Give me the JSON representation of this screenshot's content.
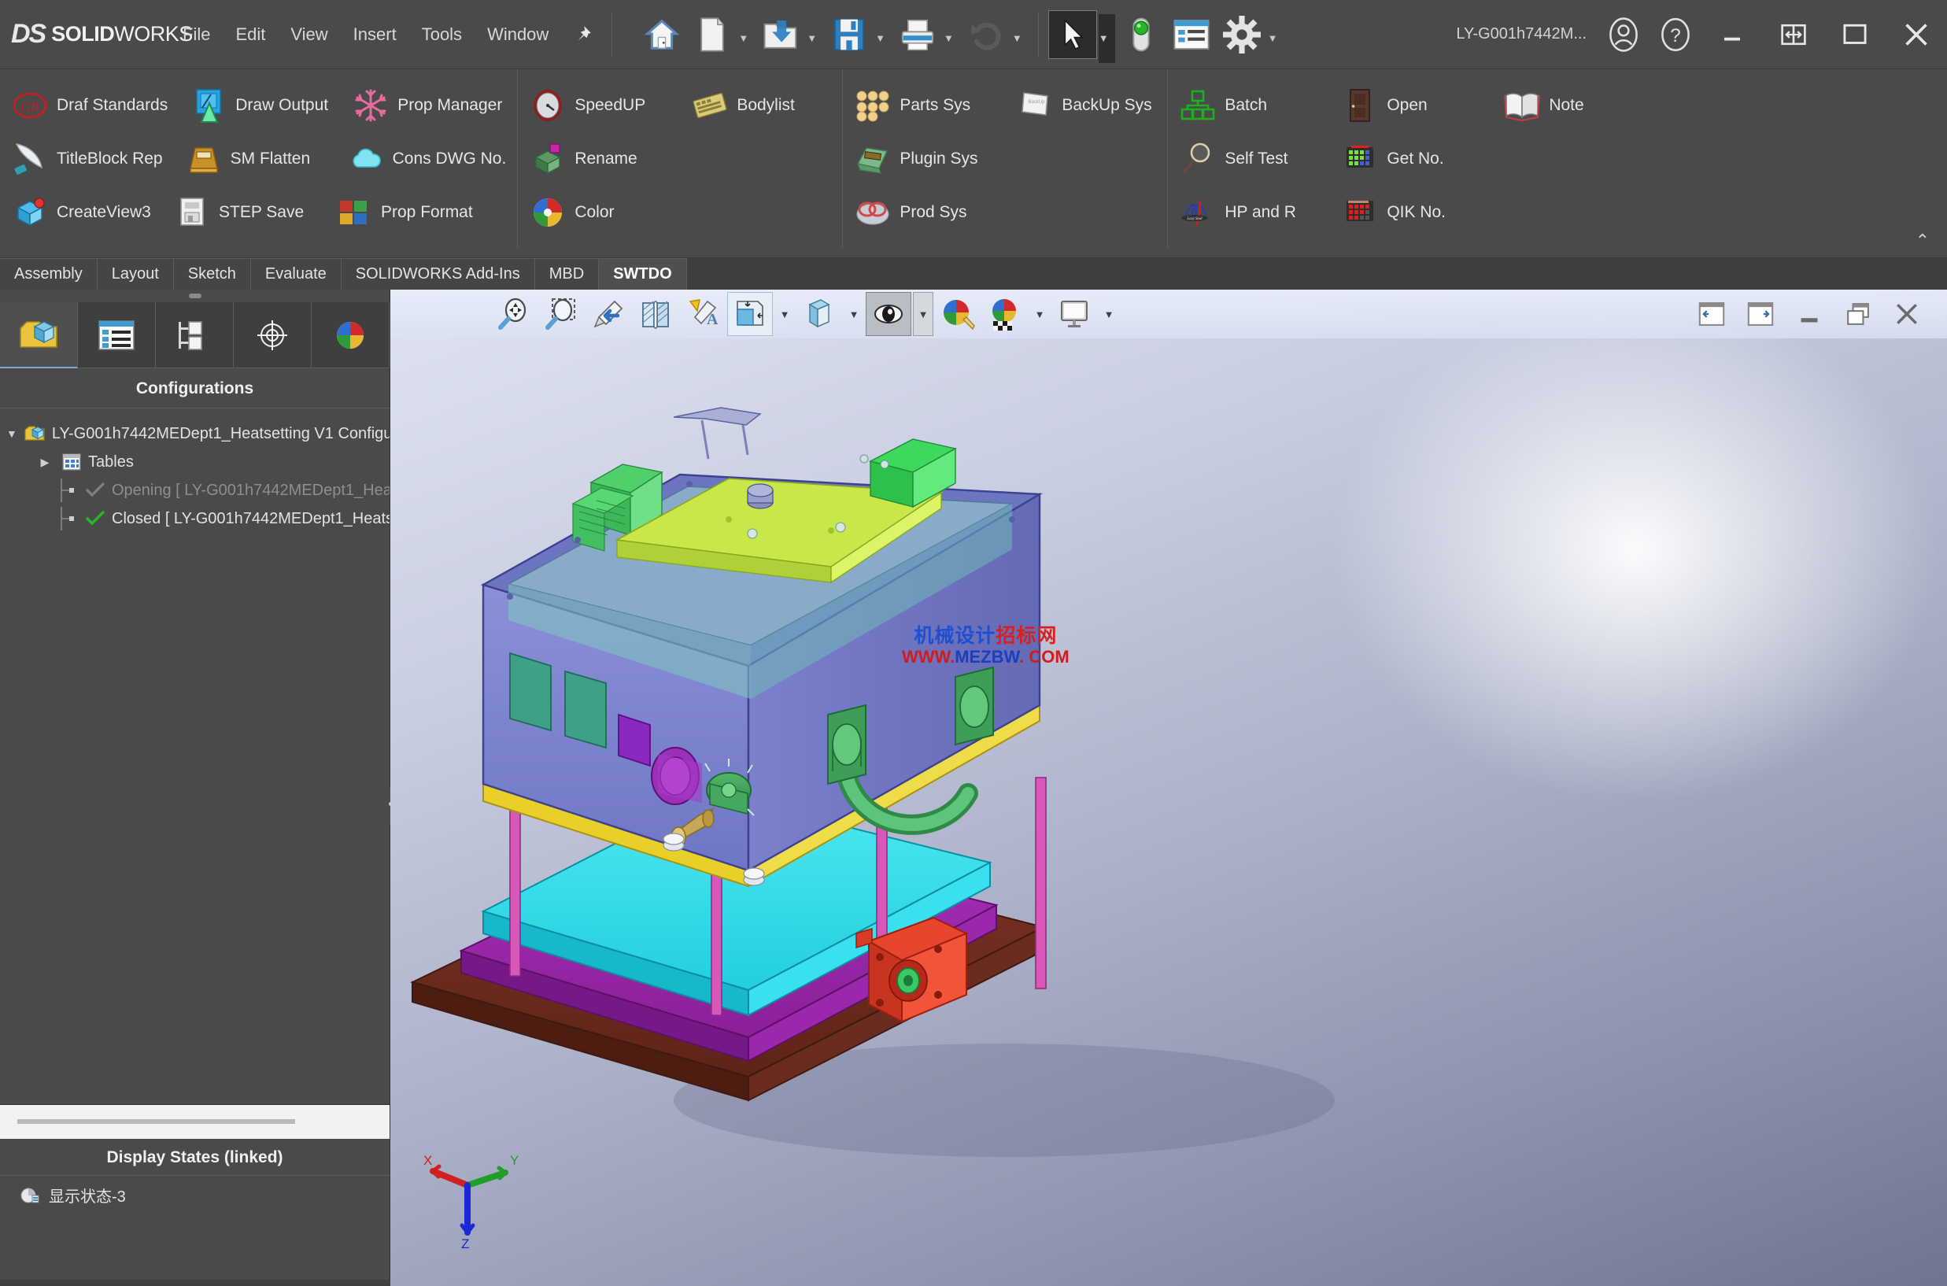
{
  "app": {
    "brand_ds": "DS",
    "brand_bold": "SOLID",
    "brand_light": "WORKS",
    "document_name": "LY-G001h7442M..."
  },
  "menubar": {
    "items": [
      {
        "label": "File"
      },
      {
        "label": "Edit"
      },
      {
        "label": "View"
      },
      {
        "label": "Insert"
      },
      {
        "label": "Tools"
      },
      {
        "label": "Window"
      }
    ],
    "pin_icon": "pushpin-icon"
  },
  "quick_access": {
    "buttons": [
      {
        "name": "home-icon",
        "label": "Home",
        "caret": false
      },
      {
        "name": "new-document-icon",
        "label": "New",
        "caret": true
      },
      {
        "name": "open-folder-icon",
        "label": "Open",
        "caret": true
      },
      {
        "name": "save-icon",
        "label": "Save",
        "caret": true
      },
      {
        "name": "print-icon",
        "label": "Print",
        "caret": true
      },
      {
        "name": "undo-icon",
        "label": "Undo",
        "caret": true
      },
      {
        "name": "select-arrow-icon",
        "label": "Select",
        "caret": true
      },
      {
        "name": "rebuild-icon",
        "label": "Rebuild",
        "caret": false
      },
      {
        "name": "options-list-icon",
        "label": "Options List",
        "caret": false
      },
      {
        "name": "settings-gear-icon",
        "label": "Options",
        "caret": true
      }
    ]
  },
  "title_right": {
    "account_icon": "user-account-icon",
    "help_icon": "help-question-icon",
    "minimize_icon": "minimize-icon",
    "restore_split_icon": "restore-split-icon",
    "maximize_icon": "maximize-icon",
    "close_icon": "close-icon"
  },
  "ribbon": {
    "collapse_icon": "chevron-up-icon",
    "groups": [
      {
        "name": "group-1",
        "rows": [
          [
            {
              "label": "Draf Standards",
              "icon": "gb-stamp-icon"
            },
            {
              "label": "Draw Output",
              "icon": "blue-drawing-icon"
            },
            {
              "label": "Prop Manager",
              "icon": "snowflake-icon"
            }
          ],
          [
            {
              "label": "TitleBlock Rep",
              "icon": "blade-icon"
            },
            {
              "label": "SM Flatten",
              "icon": "gold-tray-icon"
            },
            {
              "label": "Cons DWG No.",
              "icon": "cloud-icon"
            }
          ],
          [
            {
              "label": "CreateView3",
              "icon": "view-cube-icon"
            },
            {
              "label": "STEP Save",
              "icon": "step-save-icon"
            },
            {
              "label": "Prop Format",
              "icon": "format-blocks-icon"
            }
          ]
        ]
      },
      {
        "name": "group-2",
        "rows": [
          [
            {
              "label": "SpeedUP",
              "icon": "gauge-icon"
            },
            {
              "label": "Bodylist",
              "icon": "keyboard-icon"
            }
          ],
          [
            {
              "label": "Rename",
              "icon": "rename-box-icon"
            }
          ],
          [
            {
              "label": "Color",
              "icon": "color-wheel-icon"
            }
          ]
        ]
      },
      {
        "name": "group-3",
        "rows": [
          [
            {
              "label": "Parts Sys",
              "icon": "parts-stack-icon"
            },
            {
              "label": "BackUp Sys",
              "icon": "backup-disk-icon"
            }
          ],
          [
            {
              "label": "Plugin Sys",
              "icon": "plugin-machine-icon"
            }
          ],
          [
            {
              "label": "Prod Sys",
              "icon": "prod-rings-icon"
            }
          ]
        ]
      },
      {
        "name": "group-4",
        "rows": [
          [
            {
              "label": "Batch",
              "icon": "green-batch-icon"
            },
            {
              "label": "Open",
              "icon": "door-open-icon"
            },
            {
              "label": "Note",
              "icon": "open-book-icon"
            }
          ],
          [
            {
              "label": "Self Test",
              "icon": "magnifier-icon"
            },
            {
              "label": "Get No.",
              "icon": "green-grid-icon"
            }
          ],
          [
            {
              "label": "HP and R",
              "icon": "signature-icon"
            },
            {
              "label": "QIK No.",
              "icon": "red-grid-icon"
            }
          ]
        ]
      }
    ]
  },
  "tabs": {
    "items": [
      {
        "label": "Assembly",
        "active": false
      },
      {
        "label": "Layout",
        "active": false
      },
      {
        "label": "Sketch",
        "active": false
      },
      {
        "label": "Evaluate",
        "active": false
      },
      {
        "label": "SOLIDWORKS Add-Ins",
        "active": false
      },
      {
        "label": "MBD",
        "active": false
      },
      {
        "label": "SWTDO",
        "active": true
      }
    ]
  },
  "left_panel": {
    "tabs": [
      {
        "name": "feature-manager-tab",
        "icon": "yellow-cube-tree-icon",
        "active": true
      },
      {
        "name": "property-manager-tab",
        "icon": "property-list-icon",
        "active": false
      },
      {
        "name": "configuration-manager-tab",
        "icon": "configuration-tree-icon",
        "active": false
      },
      {
        "name": "dimxpert-manager-tab",
        "icon": "crosshair-target-icon",
        "active": false
      },
      {
        "name": "display-manager-tab",
        "icon": "color-sphere-icon",
        "active": false
      }
    ],
    "title": "Configurations",
    "tree": [
      {
        "label": "LY-G001h7442MEDept1_Heatsetting V1 Configur",
        "level": 0,
        "twisty": "expanded",
        "icon": "config-root-icon",
        "dim": false
      },
      {
        "label": "Tables",
        "level": 1,
        "twisty": "collapsed",
        "icon": "tables-icon",
        "dim": false
      },
      {
        "label": "Opening [ LY-G001h7442MEDept1_Hea",
        "level": 2,
        "twisty": "none",
        "icon": "check-grey-icon",
        "dim": true
      },
      {
        "label": "Closed [ LY-G001h7442MEDept1_Heats",
        "level": 2,
        "twisty": "none",
        "icon": "check-green-icon",
        "dim": false
      }
    ],
    "display_states_title": "Display States (linked)",
    "display_states_items": [
      {
        "label": "显示状态-3",
        "icon": "display-state-icon"
      }
    ]
  },
  "viewport_toolbar": {
    "left_buttons": [
      {
        "name": "zoom-to-fit-icon",
        "label": "Zoom to Fit",
        "caret": false,
        "pressed": false
      },
      {
        "name": "zoom-to-area-icon",
        "label": "Zoom to Area",
        "caret": false,
        "pressed": false
      },
      {
        "name": "previous-view-icon",
        "label": "Previous View",
        "caret": false,
        "pressed": false
      },
      {
        "name": "section-view-icon",
        "label": "Section View",
        "caret": false,
        "pressed": false
      },
      {
        "name": "dynamic-annotation-icon",
        "label": "Dynamic Annotation Views",
        "caret": false,
        "pressed": false
      },
      {
        "name": "view-orientation-icon",
        "label": "View Orientation",
        "caret": true,
        "pressed": false
      },
      {
        "name": "display-style-icon",
        "label": "Display Style",
        "caret": true,
        "pressed": false
      },
      {
        "name": "hide-show-items-icon",
        "label": "Hide/Show Items",
        "caret": true,
        "pressed": true
      },
      {
        "name": "edit-appearance-icon",
        "label": "Edit Appearance",
        "caret": false,
        "pressed": false
      },
      {
        "name": "apply-scene-icon",
        "label": "Apply Scene",
        "caret": true,
        "pressed": false
      },
      {
        "name": "view-settings-icon",
        "label": "View Settings",
        "caret": true,
        "pressed": false
      }
    ],
    "right_buttons": [
      {
        "name": "pane-left-icon",
        "label": "Collapse Left Pane"
      },
      {
        "name": "pane-right-icon",
        "label": "Collapse Right Pane"
      },
      {
        "name": "doc-minimize-icon",
        "label": "Minimize Document"
      },
      {
        "name": "doc-restore-icon",
        "label": "Restore Document"
      },
      {
        "name": "doc-close-icon",
        "label": "Close Document"
      }
    ]
  },
  "watermark": {
    "line1_blue": "机械设计",
    "line1_red": "招标网",
    "line2_red": "WWW.",
    "line2_blue": "MEZBW",
    "line2_red2": ". COM"
  },
  "triad": {
    "x_label": "X",
    "y_label": "Y",
    "z_label": "Z",
    "x_color": "#d02020",
    "y_color": "#1f9e2a",
    "z_color": "#1a28d8"
  },
  "colors": {
    "chrome_bg": "#4a4a4a",
    "chrome_text": "#e6e6e6",
    "tab_active_bg": "#4f4f4f",
    "viewport_top": "#dfe3f0",
    "viewport_bottom": "#6f7490"
  }
}
